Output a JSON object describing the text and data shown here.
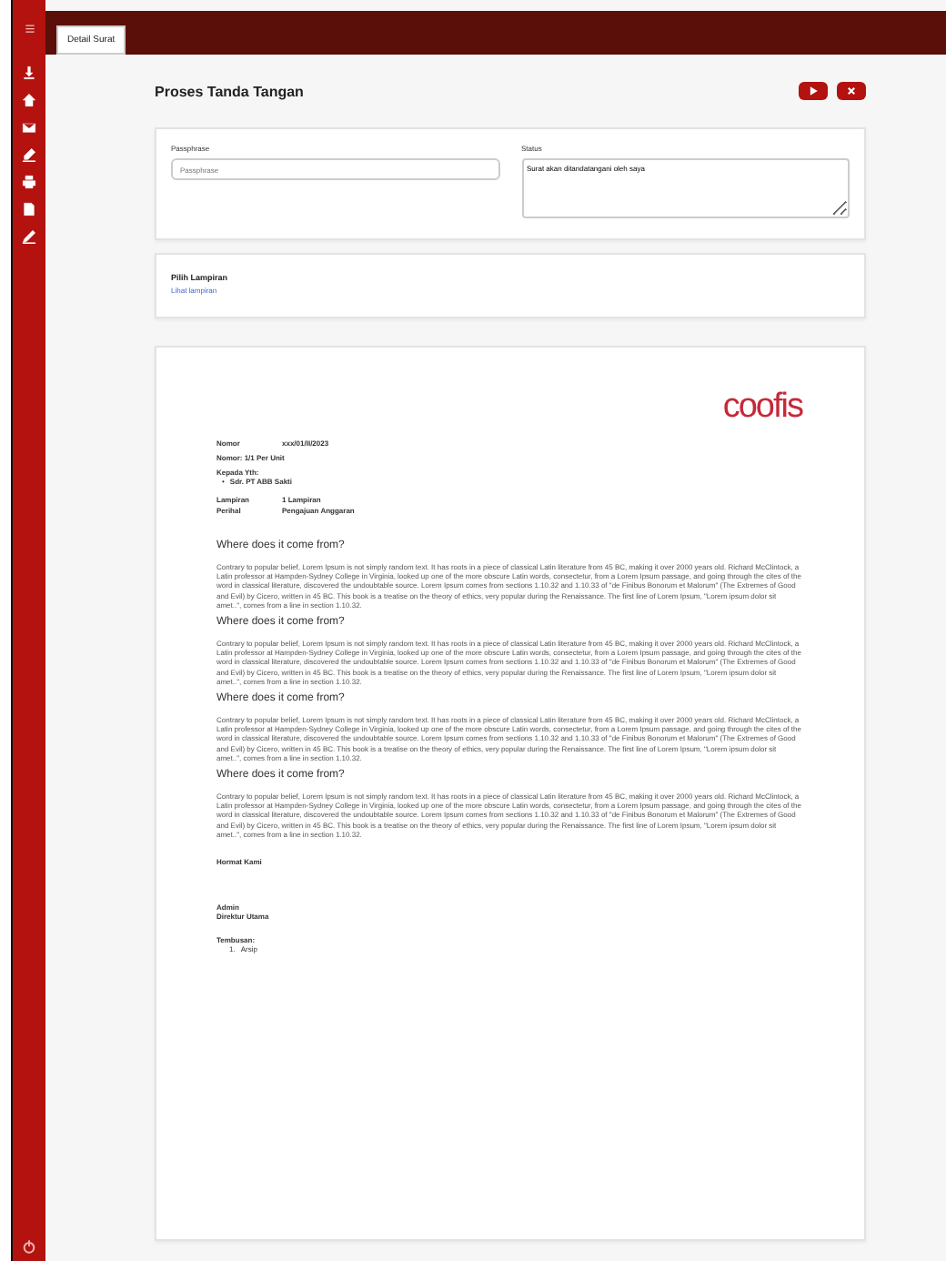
{
  "tabs": [
    {
      "label": "Detail Surat",
      "selected": true
    }
  ],
  "sidebar": {
    "items": [
      {
        "kind": "download"
      },
      {
        "kind": "home"
      },
      {
        "kind": "mail"
      },
      {
        "kind": "edit"
      },
      {
        "kind": "print"
      },
      {
        "kind": "file"
      },
      {
        "kind": "pen"
      }
    ]
  },
  "page": {
    "title": "Proses Tanda Tangan"
  },
  "form": {
    "fields": [
      {
        "label": "Passphrase",
        "placeholder": "Passphrase",
        "kind": "input"
      },
      {
        "label": "Status",
        "value": "Surat akan ditandatangani oleh saya",
        "kind": "textarea"
      }
    ]
  },
  "attachment": {
    "label": "Pilih Lampiran",
    "link": "Lihat lampiran"
  },
  "document": {
    "logo": "coofis",
    "meta": [
      {
        "label": "Nomor",
        "value": "xxx/01/II/2023"
      }
    ],
    "subject_line": "Nomor: 1/1 Per Unit",
    "recipient_label": "Kepada Yth:",
    "recipients": [
      {
        "marker": "•",
        "text": "Sdr. PT ABB Sakti"
      }
    ],
    "meta2": [
      {
        "label": "Lampiran",
        "value": "1 Lampiran"
      },
      {
        "label": "Perihal",
        "value": "Pengajuan Anggaran"
      }
    ],
    "sections": [
      {
        "heading": "Where does it come from?",
        "text": "Contrary to popular belief, Lorem Ipsum is not simply random text. It has roots in a piece of classical Latin literature from 45 BC, making it over 2000 years old. Richard McClintock, a Latin professor at Hampden-Sydney College in Virginia, looked up one of the more obscure Latin words, consectetur, from a Lorem Ipsum passage, and going through the cites of the word in classical literature, discovered the undoubtable source. Lorem Ipsum comes from sections 1.10.32 and 1.10.33 of \"de Finibus Bonorum et Malorum\" (The Extremes of Good and Evil) by Cicero, written in 45 BC. This book is a treatise on the theory of ethics, very popular during the Renaissance. The first line of Lorem Ipsum, \"Lorem ipsum dolor sit amet..\", comes from a line in section 1.10.32."
      },
      {
        "heading": "Where does it come from?",
        "text": "Contrary to popular belief, Lorem Ipsum is not simply random text. It has roots in a piece of classical Latin literature from 45 BC, making it over 2000 years old. Richard McClintock, a Latin professor at Hampden-Sydney College in Virginia, looked up one of the more obscure Latin words, consectetur, from a Lorem Ipsum passage, and going through the cites of the word in classical literature, discovered the undoubtable source. Lorem Ipsum comes from sections 1.10.32 and 1.10.33 of \"de Finibus Bonorum et Malorum\" (The Extremes of Good and Evil) by Cicero, written in 45 BC. This book is a treatise on the theory of ethics, very popular during the Renaissance. The first line of Lorem Ipsum, \"Lorem ipsum dolor sit amet..\", comes from a line in section 1.10.32."
      },
      {
        "heading": "Where does it come from?",
        "text": "Contrary to popular belief, Lorem Ipsum is not simply random text. It has roots in a piece of classical Latin literature from 45 BC, making it over 2000 years old. Richard McClintock, a Latin professor at Hampden-Sydney College in Virginia, looked up one of the more obscure Latin words, consectetur, from a Lorem Ipsum passage, and going through the cites of the word in classical literature, discovered the undoubtable source. Lorem Ipsum comes from sections 1.10.32 and 1.10.33 of \"de Finibus Bonorum et Malorum\" (The Extremes of Good and Evil) by Cicero, written in 45 BC. This book is a treatise on the theory of ethics, very popular during the Renaissance. The first line of Lorem Ipsum, \"Lorem ipsum dolor sit amet..\", comes from a line in section 1.10.32."
      },
      {
        "heading": "Where does it come from?",
        "text": "Contrary to popular belief, Lorem Ipsum is not simply random text. It has roots in a piece of classical Latin literature from 45 BC, making it over 2000 years old. Richard McClintock, a Latin professor at Hampden-Sydney College in Virginia, looked up one of the more obscure Latin words, consectetur, from a Lorem Ipsum passage, and going through the cites of the word in classical literature, discovered the undoubtable source. Lorem Ipsum comes from sections 1.10.32 and 1.10.33 of \"de Finibus Bonorum et Malorum\" (The Extremes of Good and Evil) by Cicero, written in 45 BC. This book is a treatise on the theory of ethics, very popular during the Renaissance. The first line of Lorem Ipsum, \"Lorem ipsum dolor sit amet..\", comes from a line in section 1.10.32."
      }
    ],
    "closing": "Hormat Kami",
    "signer_role": "Admin",
    "signer_name": "Direktur Utama",
    "cc_label": "Tembusan:",
    "cc": [
      {
        "marker": "1.",
        "text": "Arsip"
      }
    ]
  }
}
